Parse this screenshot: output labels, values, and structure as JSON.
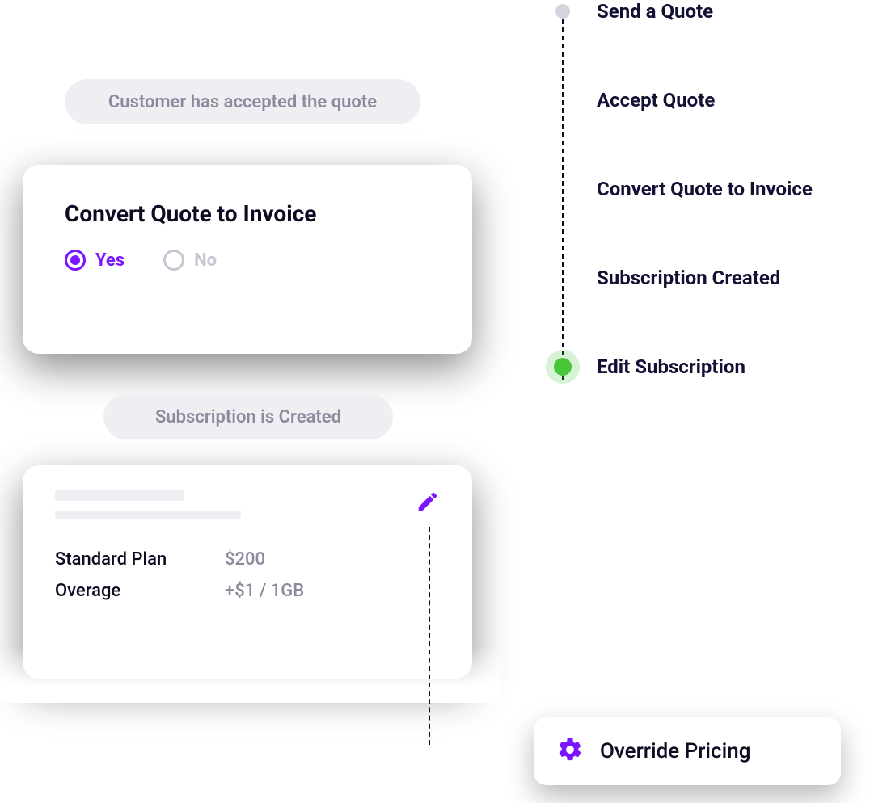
{
  "labels": {
    "pill_accepted": "Customer has accepted the quote",
    "pill_sub_created": "Subscription is Created"
  },
  "convert_card": {
    "title": "Convert Quote to Invoice",
    "yes": "Yes",
    "no": "No",
    "selected": "yes"
  },
  "plan": {
    "rows": [
      {
        "label": "Standard Plan",
        "value": "$200"
      },
      {
        "label": "Overage",
        "value": "+$1 / 1GB"
      }
    ]
  },
  "timeline": {
    "items": [
      {
        "label": "Send a Quote",
        "state": "done"
      },
      {
        "label": "Accept Quote",
        "state": "pending"
      },
      {
        "label": "Convert Quote to Invoice",
        "state": "pending"
      },
      {
        "label": "Subscription Created",
        "state": "pending"
      },
      {
        "label": "Edit Subscription",
        "state": "active"
      }
    ]
  },
  "override": {
    "label": "Override Pricing"
  },
  "colors": {
    "accent_purple": "#7a16ff",
    "accent_green": "#48c639",
    "text_dark": "#0f0a21",
    "text_muted": "#8e8a9d"
  },
  "icons": {
    "pencil": "pencil-icon",
    "gear": "gear-icon"
  }
}
